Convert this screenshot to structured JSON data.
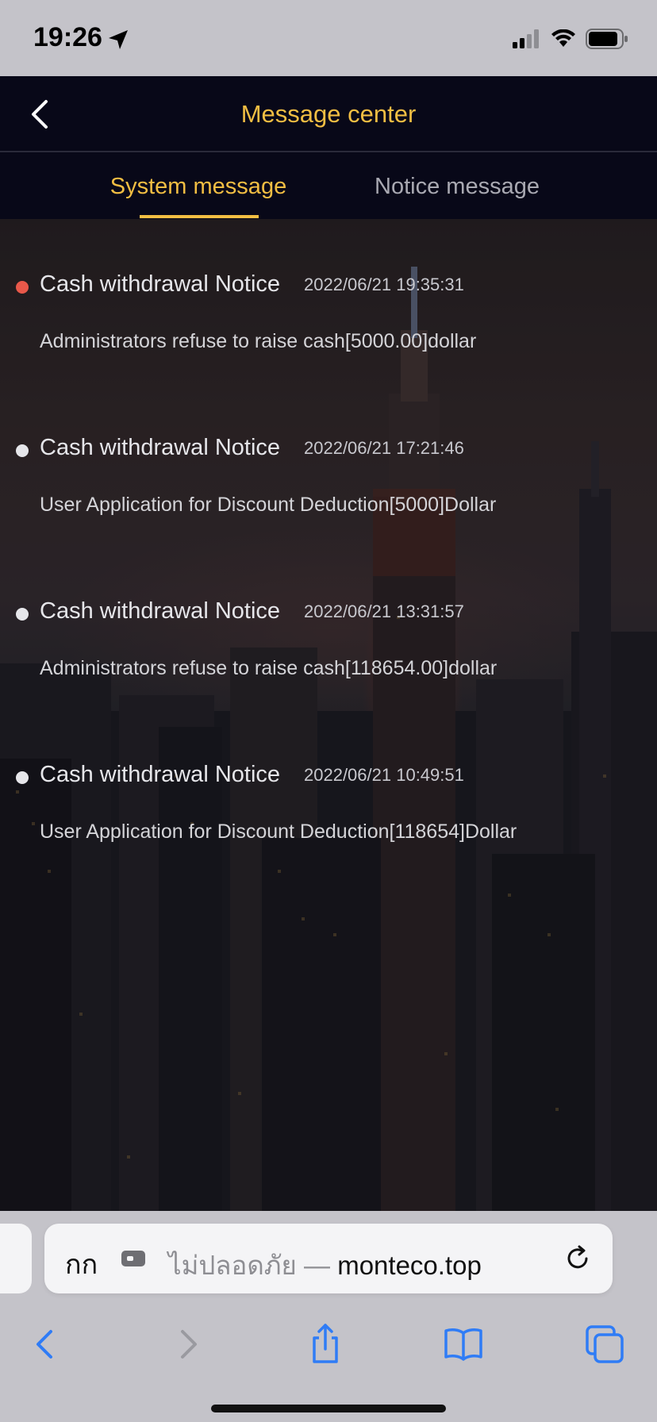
{
  "status_bar": {
    "time": "19:26",
    "icons": [
      "location-arrow-icon",
      "cellular-signal-icon",
      "wifi-icon",
      "battery-icon"
    ]
  },
  "header": {
    "title": "Message center",
    "back_icon": "chevron-left-icon"
  },
  "tabs": [
    {
      "label": "System message",
      "active": true
    },
    {
      "label": "Notice message",
      "active": false
    }
  ],
  "messages": [
    {
      "title": "Cash withdrawal Notice",
      "time": "2022/06/21 19:35:31",
      "body": "Administrators refuse to raise cash[5000.00]dollar",
      "unread": true
    },
    {
      "title": "Cash withdrawal Notice",
      "time": "2022/06/21 17:21:46",
      "body": "User Application for Discount Deduction[5000]Dollar",
      "unread": false
    },
    {
      "title": "Cash withdrawal Notice",
      "time": "2022/06/21 13:31:57",
      "body": "Administrators refuse to raise cash[118654.00]dollar",
      "unread": false
    },
    {
      "title": "Cash withdrawal Notice",
      "time": "2022/06/21 10:49:51",
      "body": "User Application for Discount Deduction[118654]Dollar",
      "unread": false
    }
  ],
  "browser": {
    "text_size_label": "กก",
    "insecure_label": "ไม่ปลอดภัย — ",
    "domain": "monteco.top",
    "toolbar_icons": [
      "back-icon",
      "forward-icon",
      "share-icon",
      "bookmarks-icon",
      "tabs-icon"
    ]
  },
  "colors": {
    "accent": "#f2be43",
    "unread_dot": "#e8584a",
    "read_dot": "#e6e6ea",
    "header_bg": "#080818",
    "safari_blue": "#2f7cf6"
  }
}
